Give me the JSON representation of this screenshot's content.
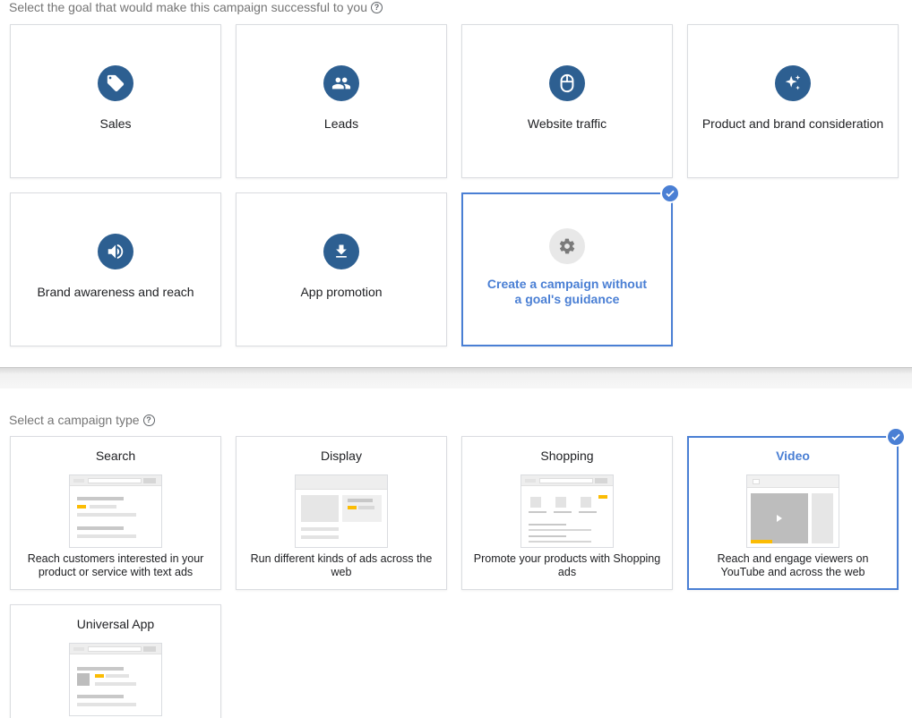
{
  "goals_section": {
    "label": "Select the goal that would make this campaign successful to you",
    "goals": [
      {
        "label": "Sales",
        "icon": "tag-icon"
      },
      {
        "label": "Leads",
        "icon": "people-icon"
      },
      {
        "label": "Website traffic",
        "icon": "mouse-icon"
      },
      {
        "label": "Product and brand consideration",
        "icon": "sparkle-icon"
      },
      {
        "label": "Brand awareness and reach",
        "icon": "speaker-icon"
      },
      {
        "label": "App promotion",
        "icon": "download-icon"
      },
      {
        "label": "Create a campaign without a goal's guidance",
        "icon": "gear-icon",
        "selected": true
      }
    ]
  },
  "types_section": {
    "label": "Select a campaign type",
    "types": [
      {
        "title": "Search",
        "description": "Reach customers interested in your product or service with text ads"
      },
      {
        "title": "Display",
        "description": "Run different kinds of ads across the web"
      },
      {
        "title": "Shopping",
        "description": "Promote your products with Shopping ads"
      },
      {
        "title": "Video",
        "description": "Reach and engage viewers on YouTube and across the web",
        "selected": true
      },
      {
        "title": "Universal App",
        "description": ""
      }
    ]
  },
  "colors": {
    "accent": "#4a7fd4",
    "icon_circle": "#2d5f91",
    "highlight": "#fbbc04"
  }
}
